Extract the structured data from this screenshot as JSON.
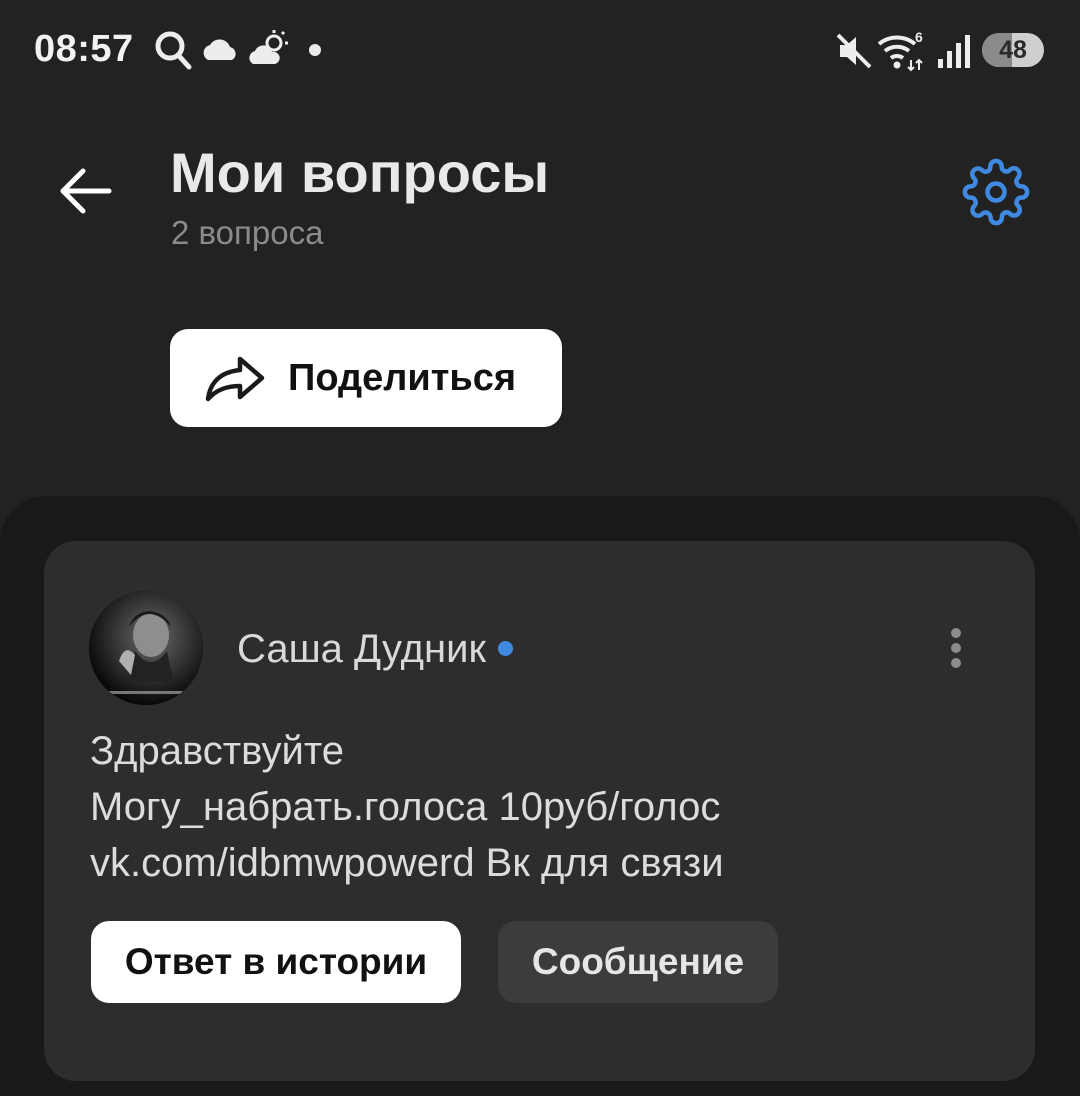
{
  "status_bar": {
    "time": "08:57",
    "battery": "48",
    "battery_level_percent": 48,
    "network_badge": "6",
    "icons": [
      "search-icon",
      "cloud-icon",
      "partly-sunny-icon",
      "notification-dot-icon",
      "mute-icon",
      "wifi-icon",
      "signal-icon",
      "battery-icon"
    ]
  },
  "header": {
    "title": "Мои вопросы",
    "subtitle": "2 вопроса",
    "back_icon": "arrow-left-icon",
    "settings_icon": "gear-icon"
  },
  "share_button": {
    "label": "Поделиться",
    "icon": "share-arrow-icon"
  },
  "card": {
    "author": "Саша Дудник",
    "online": true,
    "message_lines": [
      "Здравствуйте",
      "Могу_набрать.голоса 10руб/голос",
      "vk.com/idbmwpowerd Вк для связи"
    ],
    "actions": {
      "reply_story": "Ответ в истории",
      "message": "Сообщение"
    }
  },
  "colors": {
    "background": "#222223",
    "sheet": "#19191a",
    "card": "#2d2d2f",
    "accent": "#3f8ae0",
    "subtitle": "#8b8b8d"
  }
}
